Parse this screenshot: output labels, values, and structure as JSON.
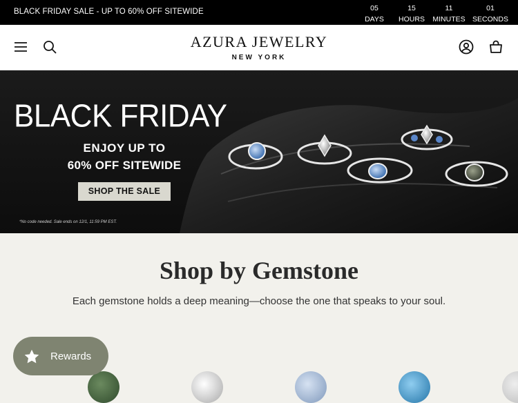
{
  "announcement": {
    "message": "BLACK FRIDAY SALE - UP TO 60% OFF SITEWIDE"
  },
  "countdown": [
    {
      "value": "05",
      "unit": "DAYS"
    },
    {
      "value": "15",
      "unit": "HOURS"
    },
    {
      "value": "11",
      "unit": "MINUTES"
    },
    {
      "value": "01",
      "unit": "SECONDS"
    }
  ],
  "header": {
    "logo_line1": "AZURA JEWELRY",
    "logo_line2": "NEW YORK",
    "icons": [
      "menu-icon",
      "search-icon",
      "account-icon",
      "cart-icon"
    ]
  },
  "hero": {
    "title": "BLACK FRIDAY",
    "line2": "ENJOY UP TO",
    "line3_bold": "60% OFF",
    "line3_rest": " SITEWIDE",
    "cta": "SHOP THE SALE",
    "fine_print": "*No code needed. Sale ends on 12/1, 11:59 PM EST."
  },
  "section": {
    "title": "Shop by Gemstone",
    "subtitle": "Each gemstone holds a deep meaning—choose the one that speaks to your soul."
  },
  "gemstones": [
    {
      "color": "#3c5a3a"
    },
    {
      "color": "#d9d9d9"
    },
    {
      "color": "#9fb4d1"
    },
    {
      "color": "#3f98c9"
    }
  ],
  "rewards": {
    "label": "Rewards"
  },
  "colors": {
    "announce_bg": "#000000",
    "hero_bg": "#111111",
    "page_bg": "#f2f1ec",
    "rewards_bg": "#7f8471",
    "cta_bg": "#d9d8cf"
  }
}
